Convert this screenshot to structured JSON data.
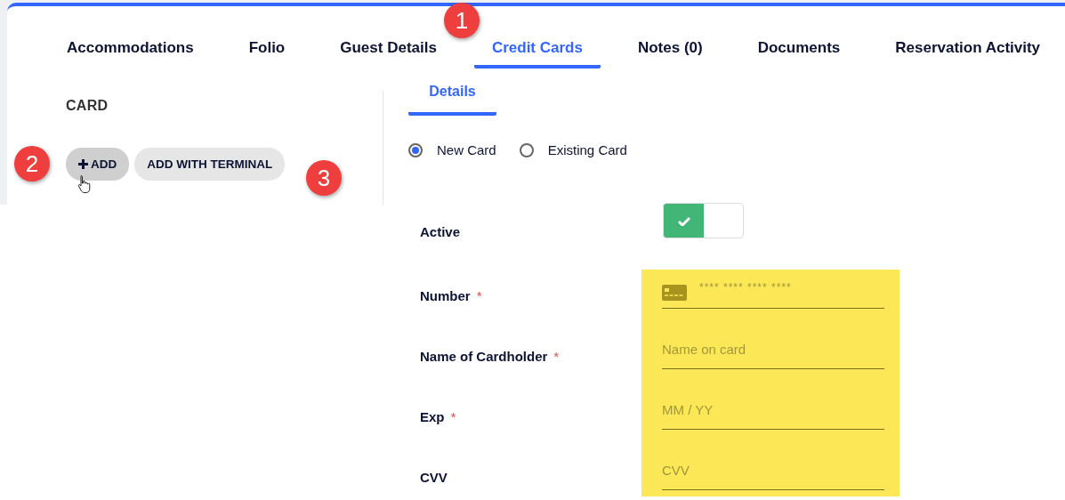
{
  "tabs": [
    {
      "label": "Accommodations",
      "selected": false
    },
    {
      "label": "Folio",
      "selected": false
    },
    {
      "label": "Guest Details",
      "selected": false
    },
    {
      "label": "Credit Cards",
      "selected": true
    },
    {
      "label": "Notes (0)",
      "selected": false
    },
    {
      "label": "Documents",
      "selected": false
    },
    {
      "label": "Reservation Activity",
      "selected": false
    }
  ],
  "card_panel": {
    "heading": "CARD",
    "buttons": [
      {
        "label": "ADD",
        "hovered": true
      },
      {
        "label": "ADD WITH TERMINAL",
        "hovered": false
      }
    ]
  },
  "details": {
    "tabs": [
      {
        "label": "Details",
        "selected": true
      }
    ],
    "radios": [
      {
        "label": "New Card",
        "selected": true
      },
      {
        "label": "Existing Card",
        "selected": false
      }
    ],
    "active": {
      "label": "Active",
      "on": true
    },
    "fields": [
      {
        "label": "Number",
        "mark": "*",
        "placeholder": "**** **** **** ****",
        "kind": "card-number"
      },
      {
        "label": "Name of Cardholder",
        "mark": "*",
        "placeholder": "Name on card",
        "kind": "text"
      },
      {
        "label": "Exp",
        "mark": "*",
        "placeholder": "MM / YY",
        "kind": "text"
      },
      {
        "label": "CVV",
        "placeholder": "CVV",
        "kind": "text"
      }
    ]
  },
  "callouts": [
    "1",
    "2",
    "3"
  ]
}
